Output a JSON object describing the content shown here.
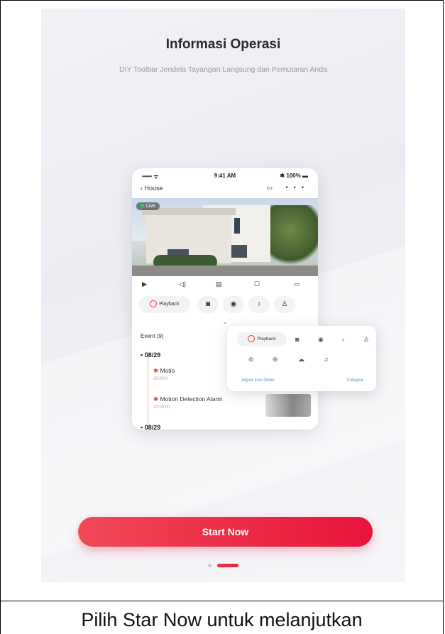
{
  "screen": {
    "title": "Informasi Operasi",
    "subtitle": "DIY Toolbar Jendela Tayangan Langsung dan Pemutaran Anda",
    "cta_label": "Start Now",
    "pager": {
      "count": 2,
      "active": 2
    }
  },
  "phone": {
    "status": {
      "left": "••••• ᯤ",
      "time": "9:41 AM",
      "right": "✱ 100% ▬"
    },
    "nav": {
      "back_label": "House",
      "right_icons": "▭ •••"
    },
    "live_badge": "Live",
    "tools": {
      "playback_label": "Playback"
    },
    "events": {
      "header": "Event (9)",
      "date1": "08/29",
      "item1_title": "Motio",
      "item1_time": "20:00:0",
      "item2_title": "Motion Detection Alarm",
      "item2_time": "20:00:00",
      "date2": "08/29"
    }
  },
  "popup": {
    "playback_label": "Playback",
    "adjust_label": "Adjust Icon Order",
    "collapse_label": "Collapse"
  },
  "caption": "Pilih Star Now untuk melanjutkan",
  "colors": {
    "accent": "#e8133a",
    "link": "#4a8fd9"
  }
}
